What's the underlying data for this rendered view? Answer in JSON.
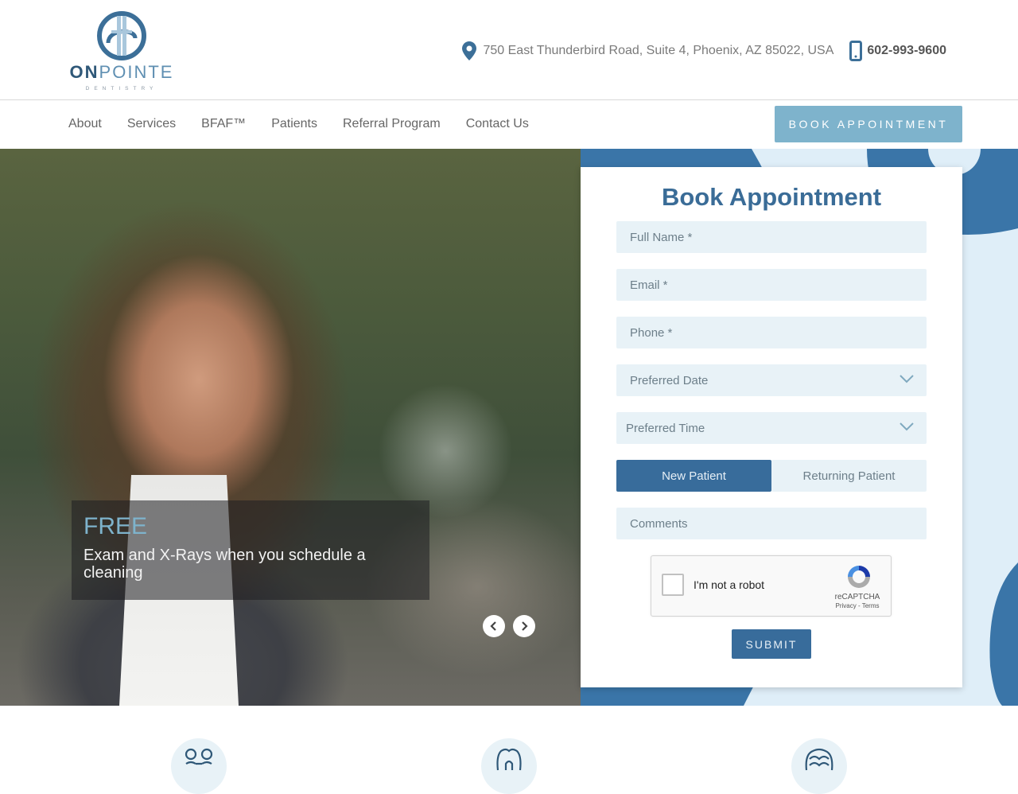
{
  "brand": {
    "name_bold": "ON",
    "name_rest": "POINTE",
    "tagline": "DENTISTRY"
  },
  "contact": {
    "address": "750 East Thunderbird Road, Suite 4, Phoenix, AZ 85022, USA",
    "phone": "602-993-9600"
  },
  "nav": {
    "items": [
      "About",
      "Services",
      "BFAF™",
      "Patients",
      "Referral Program",
      "Contact Us"
    ],
    "cta": "BOOK APPOINTMENT"
  },
  "hero": {
    "caption_title": "FREE",
    "caption_text": "Exam and X-Rays when you schedule a cleaning"
  },
  "form": {
    "title": "Book Appointment",
    "full_name_placeholder": "Full Name *",
    "email_placeholder": "Email *",
    "phone_placeholder": "Phone *",
    "date_placeholder": "Preferred Date",
    "time_placeholder": "Preferred Time",
    "patient_type": {
      "options": [
        "New Patient",
        "Returning Patient"
      ],
      "selected": "New Patient"
    },
    "comments_placeholder": "Comments",
    "captcha": {
      "label": "I'm not a robot",
      "brand": "reCAPTCHA",
      "links": "Privacy - Terms"
    },
    "submit": "SUBMIT"
  },
  "features": {
    "icons": [
      "braces-icon",
      "tooth-implant-icon",
      "dentures-icon"
    ]
  },
  "colors": {
    "primary": "#386c9b",
    "accent": "#7eb3cc",
    "field_bg": "#e8f2f7",
    "deco_light": "#dfeef8"
  }
}
